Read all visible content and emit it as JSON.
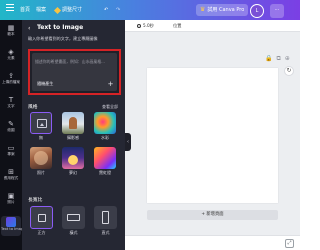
{
  "app_panel": {
    "title": "Text to Image",
    "description": "輸入你希望看到的文字，建立專屬圖像",
    "prompt": {
      "placeholder": "描述你的希望畫面，例如：山水画風格...",
      "random_label": "隨機產生"
    },
    "style_heading": "風格",
    "style_see_all": "查看全部",
    "styles": [
      {
        "label": "無",
        "selected": true
      },
      {
        "label": "攝影感",
        "selected": false
      },
      {
        "label": "水彩",
        "selected": false
      },
      {
        "label": "照片",
        "selected": false
      },
      {
        "label": "夢幻",
        "selected": false
      },
      {
        "label": "霓虹燈",
        "selected": false
      }
    ],
    "ratio_heading": "長寬比",
    "ratios": [
      {
        "label": "正方",
        "selected": true
      },
      {
        "label": "橫式",
        "selected": false
      },
      {
        "label": "直式",
        "selected": false
      }
    ]
  },
  "topbar": {
    "home": "首頁",
    "file": "檔案",
    "resize": "調整尺寸",
    "try_pro": "試用 Canva Pro",
    "avatar": "L"
  },
  "rail": [
    {
      "label": "範本",
      "icon": "template-icon"
    },
    {
      "label": "元素",
      "icon": "elements-icon"
    },
    {
      "label": "上傳的檔案",
      "icon": "upload-icon"
    },
    {
      "label": "文字",
      "icon": "text-icon"
    },
    {
      "label": "繪圖",
      "icon": "draw-icon"
    },
    {
      "label": "專案",
      "icon": "projects-icon"
    },
    {
      "label": "應用程式",
      "icon": "apps-icon"
    },
    {
      "label": "照片",
      "icon": "photos-icon"
    },
    {
      "label": "Text to Image",
      "icon": "text-to-image-icon"
    }
  ],
  "workspace": {
    "duration": "5.0秒",
    "position": "位置",
    "add_page": "+ 新增頁面"
  }
}
